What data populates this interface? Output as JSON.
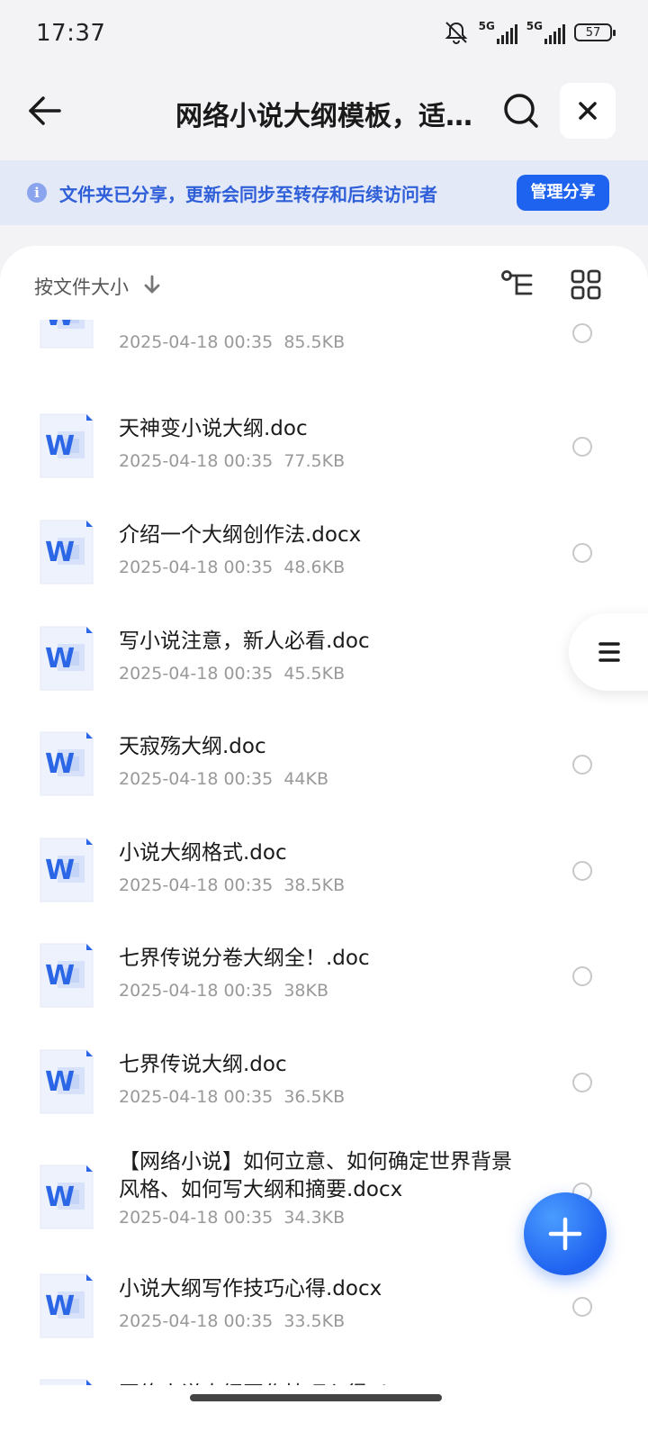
{
  "status_bar": {
    "time": "17:37",
    "network_1": "5G",
    "network_2": "5G",
    "battery": "57"
  },
  "header": {
    "title": "网络小说大纲模板，适…"
  },
  "share_banner": {
    "text": "文件夹已分享，更新会同步至转存和后续访问者",
    "manage_label": "管理分享"
  },
  "sort": {
    "label": "按文件大小"
  },
  "files": [
    {
      "name": "",
      "date": "2025-04-18 00:35",
      "size": "85.5KB"
    },
    {
      "name": "天神变小说大纲.doc",
      "date": "2025-04-18 00:35",
      "size": "77.5KB"
    },
    {
      "name": "介绍一个大纲创作法.docx",
      "date": "2025-04-18 00:35",
      "size": "48.6KB"
    },
    {
      "name": "写小说注意，新人必看.doc",
      "date": "2025-04-18 00:35",
      "size": "45.5KB"
    },
    {
      "name": "天寂殇大纲.doc",
      "date": "2025-04-18 00:35",
      "size": "44KB"
    },
    {
      "name": "小说大纲格式.doc",
      "date": "2025-04-18 00:35",
      "size": "38.5KB"
    },
    {
      "name": "七界传说分卷大纲全！.doc",
      "date": "2025-04-18 00:35",
      "size": "38KB"
    },
    {
      "name": "七界传说大纲.doc",
      "date": "2025-04-18 00:35",
      "size": "36.5KB"
    },
    {
      "name": "【网络小说】如何立意、如何确定世界背景风格、如何写大纲和摘要.docx",
      "date": "2025-04-18 00:35",
      "size": "34.3KB"
    },
    {
      "name": "小说大纲写作技巧心得.docx",
      "date": "2025-04-18 00:35",
      "size": "33.5KB"
    },
    {
      "name": "网络小说大纲写作技巧心得.docx",
      "date": "",
      "size": ""
    }
  ],
  "file_icon_letter": "W",
  "colors": {
    "accent": "#1e63f0",
    "banner_bg": "#e4e9f8",
    "banner_text": "#2f5fd8"
  }
}
